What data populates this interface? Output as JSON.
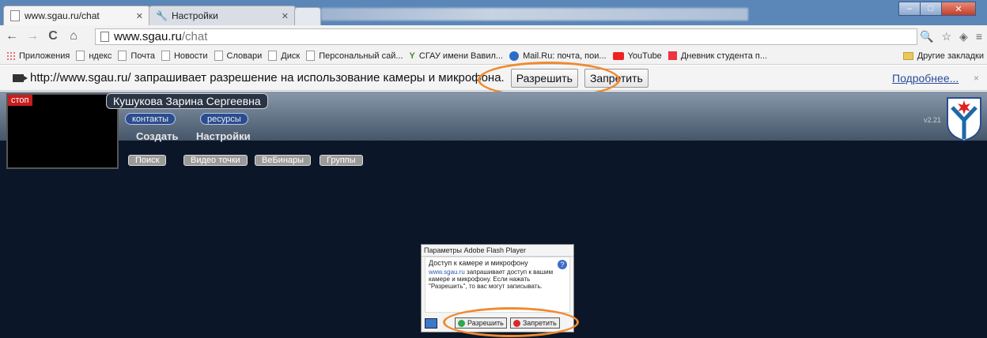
{
  "tabs": [
    {
      "title": "www.sgau.ru/chat"
    },
    {
      "title": "Настройки"
    }
  ],
  "window": {
    "minimize": "–",
    "maximize": "□",
    "close": "✕"
  },
  "toolbar": {
    "url_host": "www.sgau.ru",
    "url_path": "/chat",
    "back": "←",
    "forward": "→",
    "reload": "C",
    "home": "⌂"
  },
  "bookmarks": [
    {
      "label": "Приложения"
    },
    {
      "label": "ндекс"
    },
    {
      "label": "Почта"
    },
    {
      "label": "Новости"
    },
    {
      "label": "Словари"
    },
    {
      "label": "Диск"
    },
    {
      "label": "Персональный сай..."
    },
    {
      "label": "СГАУ имени Вавил..."
    },
    {
      "label": "Mail.Ru: почта, пои..."
    },
    {
      "label": "YouTube"
    },
    {
      "label": "Дневник студента п..."
    }
  ],
  "other_bookmarks": "Другие закладки",
  "infobar": {
    "message": "http://www.sgau.ru/ запрашивает разрешение на использование камеры и микрофона.",
    "allow": "Разрешить",
    "deny": "Запретить",
    "more": "Подробнее...",
    "close": "×"
  },
  "app": {
    "stop": "стоп",
    "user_name": "Кушукова Зарина Сергеевна",
    "contacts": "контакты",
    "resources": "ресурсы",
    "menu_create": "Создать",
    "menu_settings": "Настройки",
    "version": "v2.21",
    "buttons": [
      "Поиск",
      "Видео точки",
      "ВеБинары",
      "Группы"
    ]
  },
  "flash": {
    "title": "Параметры Adobe Flash Player",
    "heading": "Доступ к камере и микрофону",
    "link": "www.sgau.ru",
    "text": " запрашивает доступ к вашим камере и микрофону. Если нажать \"Разрешить\", то вас могут записывать.",
    "help": "?",
    "allow": "Разрешить",
    "deny": "Запретить"
  },
  "colors": {
    "highlight": "#ef8a2e",
    "page_bg": "#0b1628"
  }
}
